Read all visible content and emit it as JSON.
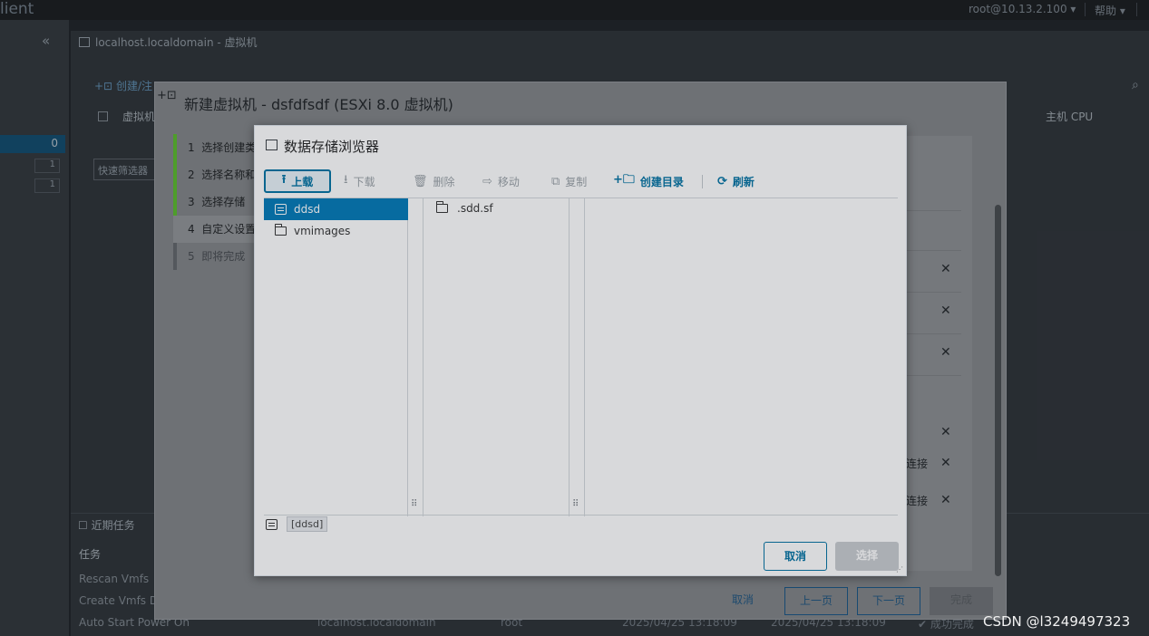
{
  "app": {
    "brand": "lient",
    "user": "root@10.13.2.100",
    "help": "帮助"
  },
  "background": {
    "breadcrumb": "localhost.localdomain - 虚拟机",
    "toolbar_create": "创建/注",
    "column_vm": "虚拟机",
    "column_host_cpu": "主机 CPU",
    "filter_placeholder": "快速筛选器",
    "sidebar_selected_count": "0",
    "sidebar_counts": [
      "1",
      "1"
    ],
    "recent_tasks": "近期任务",
    "tasks_header": "任务",
    "tasks": [
      "Rescan Vmfs",
      "Create Vmfs D",
      "Auto Start Power On"
    ],
    "task_target": "localhost.localdomain",
    "task_initiator": "root",
    "task_queued": "2025/04/25 13:18:09",
    "task_started": "2025/04/25 13:18:09",
    "task_result": "成功完成"
  },
  "wizard": {
    "title": "新建虚拟机 - dsfdfsdf (ESXi 8.0 虚拟机)",
    "steps": [
      {
        "num": "1",
        "label": "选择创建类"
      },
      {
        "num": "2",
        "label": "选择名称和"
      },
      {
        "num": "3",
        "label": "选择存储"
      },
      {
        "num": "4",
        "label": "自定义设置"
      },
      {
        "num": "5",
        "label": "即将完成"
      }
    ],
    "connect_label": "连接",
    "cancel": "取消",
    "prev": "上一页",
    "next": "下一页",
    "finish": "完成"
  },
  "browser": {
    "title": "数据存储浏览器",
    "toolbar": {
      "upload": "上载",
      "download": "下载",
      "delete": "删除",
      "move": "移动",
      "copy": "复制",
      "mkdir": "创建目录",
      "refresh": "刷新"
    },
    "datastores": [
      "ddsd",
      "vmimages"
    ],
    "selected_datastore": "ddsd",
    "files": [
      ".sdd.sf"
    ],
    "path": "[ddsd]",
    "cancel": "取消",
    "select": "选择"
  },
  "watermark": "CSDN @l3249497323",
  "colors": {
    "accent": "#0072a3",
    "selected_row": "#0079b8",
    "step_complete": "#4e9d2b"
  }
}
